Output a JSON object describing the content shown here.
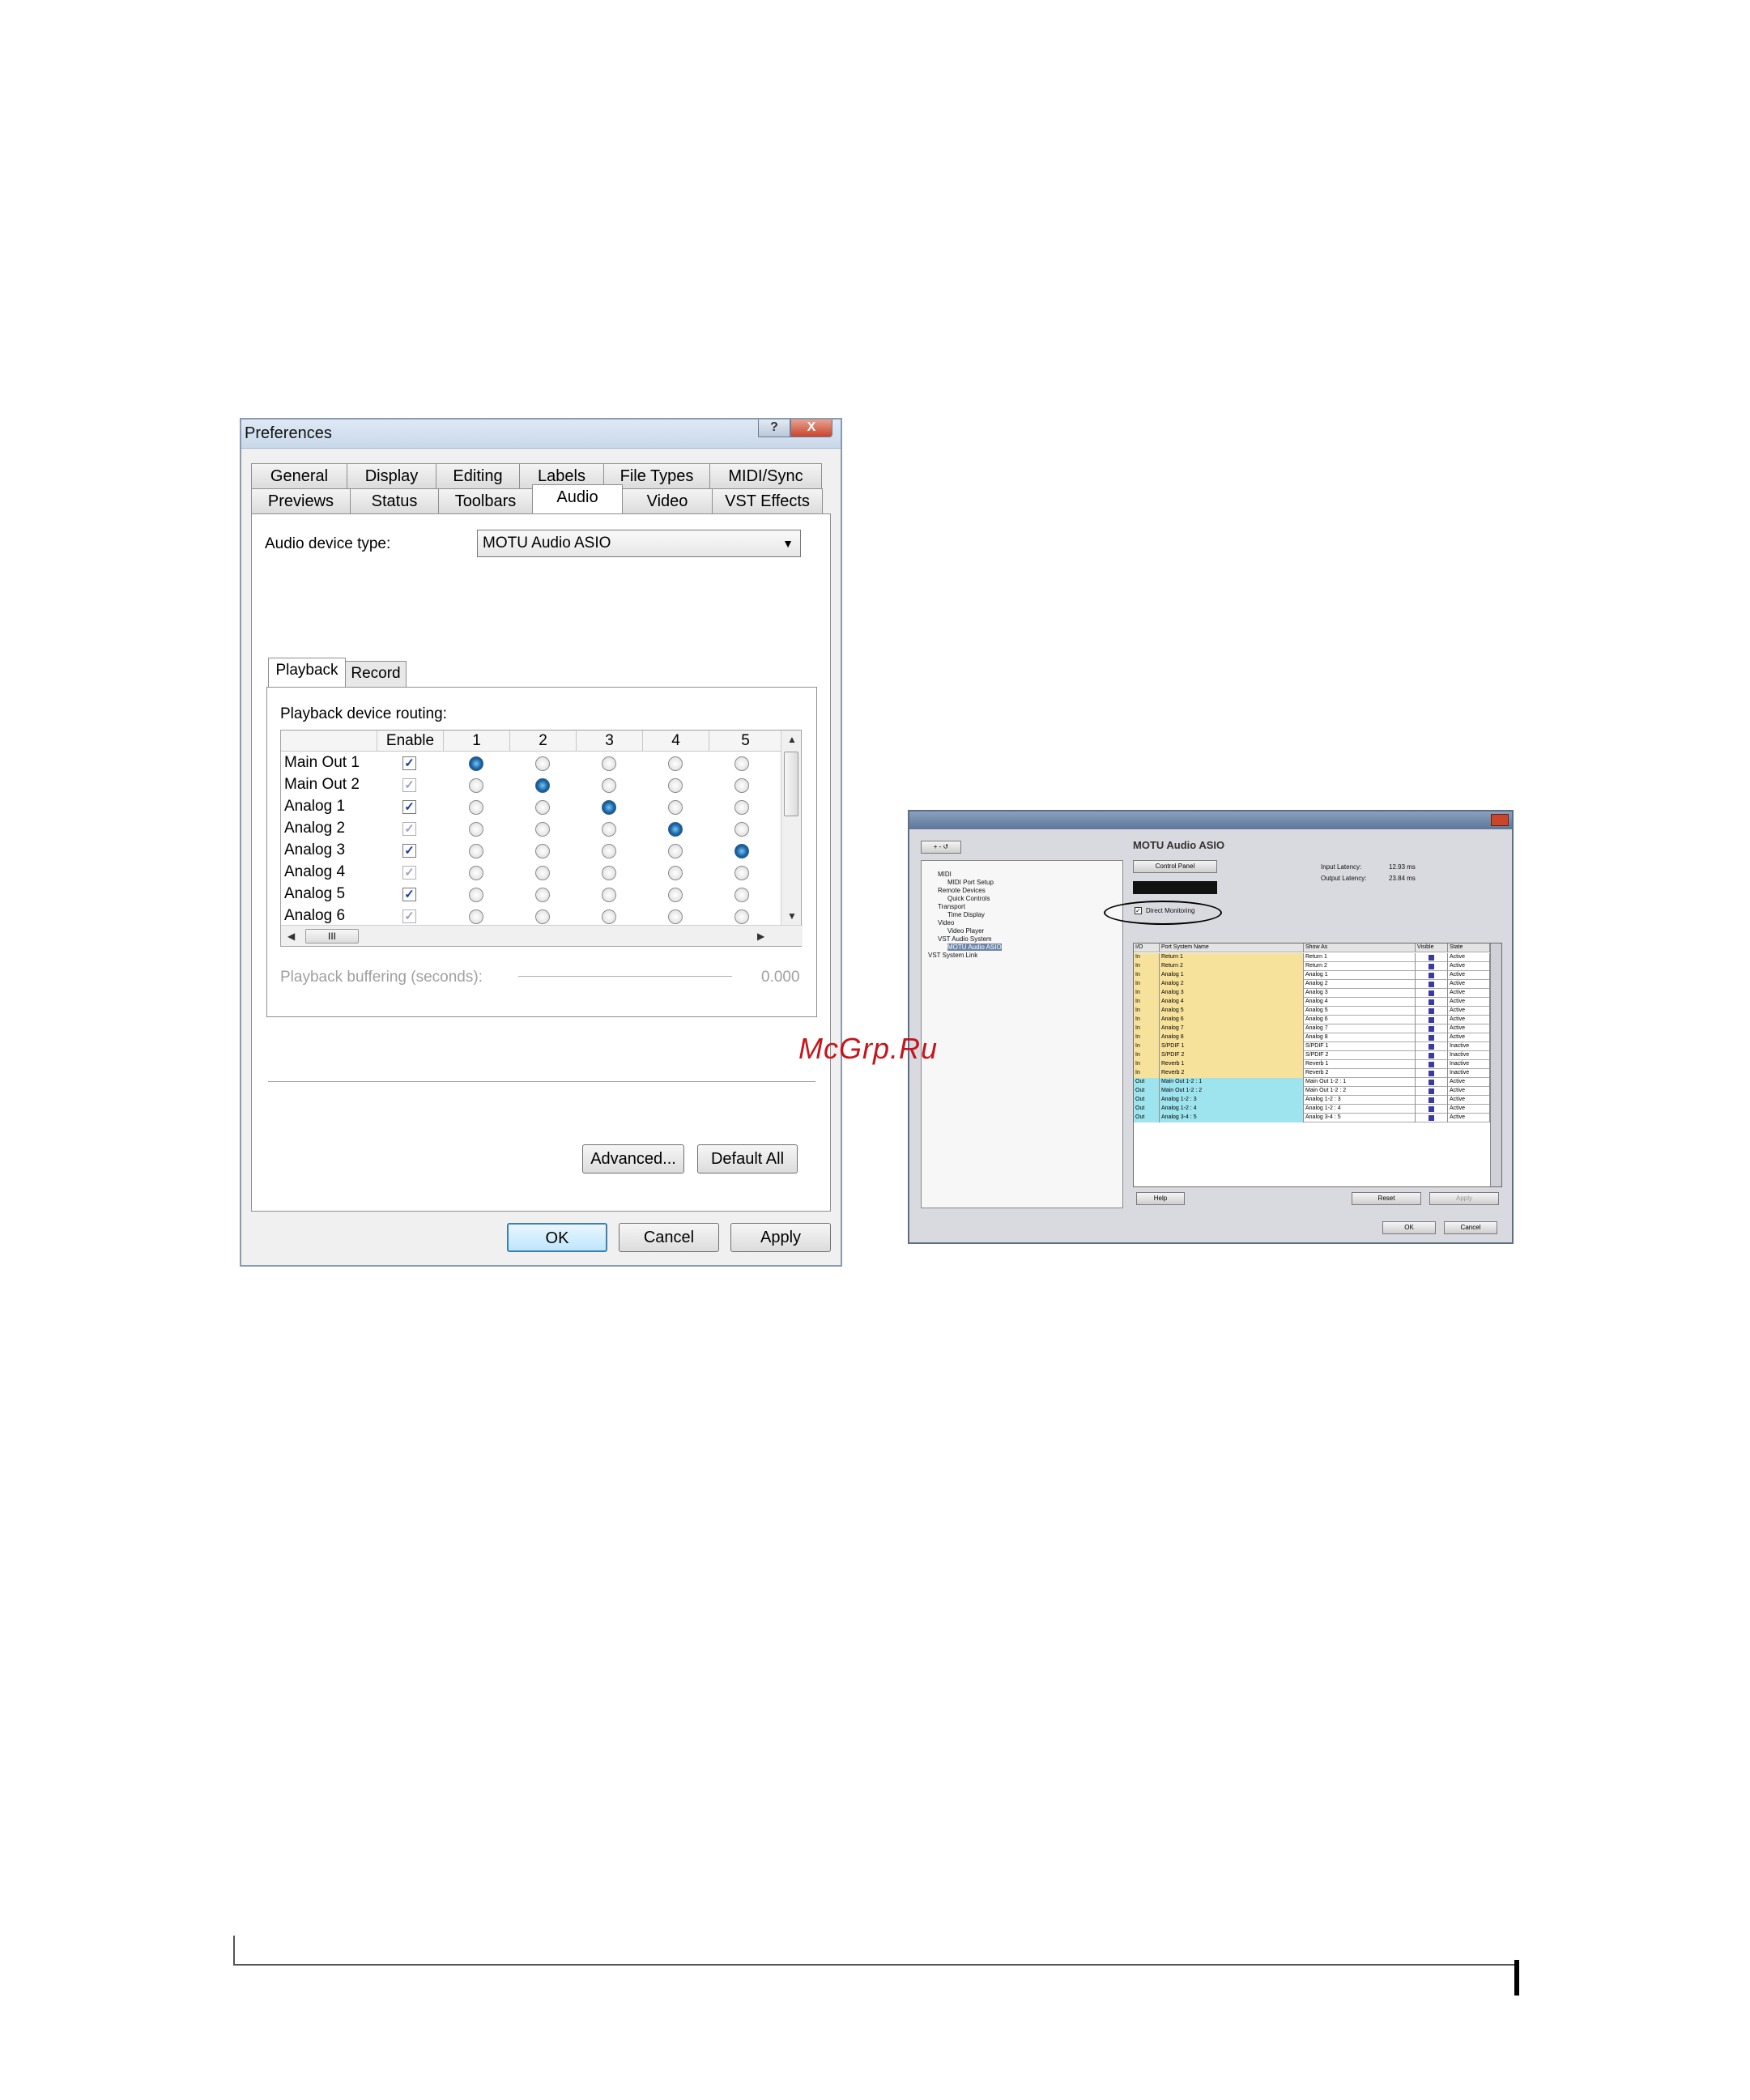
{
  "preferences": {
    "title": "Preferences",
    "help_glyph": "?",
    "close_glyph": "X",
    "tabs_row1": [
      "General",
      "Display",
      "Editing",
      "Labels",
      "File Types",
      "MIDI/Sync"
    ],
    "tabs_row2": [
      "Previews",
      "Status",
      "Toolbars",
      "Audio",
      "Video",
      "VST Effects"
    ],
    "active_tab": "Audio",
    "audio_device_type_label": "Audio device type:",
    "audio_device_type_value": "MOTU Audio ASIO",
    "subtabs": [
      "Playback",
      "Record"
    ],
    "active_subtab": "Playback",
    "routing_label": "Playback device routing:",
    "routing_columns": [
      "Enable",
      "1",
      "2",
      "3",
      "4",
      "5"
    ],
    "routing_rows": [
      {
        "name": "Main Out 1",
        "enabled": true,
        "dimmed": false,
        "selected": 1
      },
      {
        "name": "Main Out 2",
        "enabled": true,
        "dimmed": true,
        "selected": 2
      },
      {
        "name": "Analog 1",
        "enabled": true,
        "dimmed": false,
        "selected": 3
      },
      {
        "name": "Analog 2",
        "enabled": true,
        "dimmed": true,
        "selected": 4
      },
      {
        "name": "Analog 3",
        "enabled": true,
        "dimmed": false,
        "selected": 5
      },
      {
        "name": "Analog 4",
        "enabled": true,
        "dimmed": true,
        "selected": 0
      },
      {
        "name": "Analog 5",
        "enabled": true,
        "dimmed": false,
        "selected": 0
      },
      {
        "name": "Analog 6",
        "enabled": true,
        "dimmed": true,
        "selected": 0
      }
    ],
    "hscroll_thumb_glyph": "III",
    "buffering_label": "Playback buffering (seconds):",
    "buffering_value": "0.000",
    "buttons": {
      "advanced": "Advanced...",
      "default_all": "Default All",
      "ok": "OK",
      "cancel": "Cancel",
      "apply": "Apply"
    }
  },
  "device_setup": {
    "device_name": "MOTU Audio ASIO",
    "control_panel": "Control Panel",
    "input_latency_label": "Input Latency:",
    "input_latency_value": "12.93 ms",
    "output_latency_label": "Output Latency:",
    "output_latency_value": "23.84 ms",
    "direct_monitoring": "Direct Monitoring",
    "tree_items": [
      "MIDI",
      "MIDI Port Setup",
      "Remote Devices",
      "Quick Controls",
      "Transport",
      "Time Display",
      "Video",
      "Video Player",
      "VST Audio System",
      "MOTU Audio ASIO",
      "VST System Link"
    ],
    "grid_headers": [
      "I/O",
      "Port System Name",
      "Show As",
      "Visible",
      "State"
    ],
    "grid_rows": [
      {
        "io": "In",
        "port": "Return 1",
        "show": "Return 1",
        "state": "Active"
      },
      {
        "io": "In",
        "port": "Return 2",
        "show": "Return 2",
        "state": "Active"
      },
      {
        "io": "In",
        "port": "Analog 1",
        "show": "Analog 1",
        "state": "Active"
      },
      {
        "io": "In",
        "port": "Analog 2",
        "show": "Analog 2",
        "state": "Active"
      },
      {
        "io": "In",
        "port": "Analog 3",
        "show": "Analog 3",
        "state": "Active"
      },
      {
        "io": "In",
        "port": "Analog 4",
        "show": "Analog 4",
        "state": "Active"
      },
      {
        "io": "In",
        "port": "Analog 5",
        "show": "Analog 5",
        "state": "Active"
      },
      {
        "io": "In",
        "port": "Analog 6",
        "show": "Analog 6",
        "state": "Active"
      },
      {
        "io": "In",
        "port": "Analog 7",
        "show": "Analog 7",
        "state": "Active"
      },
      {
        "io": "In",
        "port": "Analog 8",
        "show": "Analog 8",
        "state": "Active"
      },
      {
        "io": "In",
        "port": "S/PDIF 1",
        "show": "S/PDIF 1",
        "state": "Inactive"
      },
      {
        "io": "In",
        "port": "S/PDIF 2",
        "show": "S/PDIF 2",
        "state": "Inactive"
      },
      {
        "io": "In",
        "port": "Reverb 1",
        "show": "Reverb 1",
        "state": "Inactive"
      },
      {
        "io": "In",
        "port": "Reverb 2",
        "show": "Reverb 2",
        "state": "Inactive"
      },
      {
        "io": "Out",
        "port": "Main Out 1-2 : 1",
        "show": "Main Out 1-2 : 1",
        "state": "Active"
      },
      {
        "io": "Out",
        "port": "Main Out 1-2 : 2",
        "show": "Main Out 1-2 : 2",
        "state": "Active"
      },
      {
        "io": "Out",
        "port": "Analog 1-2 : 3",
        "show": "Analog 1-2 : 3",
        "state": "Active"
      },
      {
        "io": "Out",
        "port": "Analog 1-2 : 4",
        "show": "Analog 1-2 : 4",
        "state": "Active"
      },
      {
        "io": "Out",
        "port": "Analog 3-4 : 5",
        "show": "Analog 3-4 : 5",
        "state": "Active"
      }
    ],
    "buttons": {
      "help": "Help",
      "reset": "Reset",
      "apply": "Apply",
      "ok": "OK",
      "cancel": "Cancel"
    }
  },
  "watermark": "McGrp.Ru",
  "colors": {
    "accent": "#3c7fb1",
    "radio_on": "#1565a8",
    "in_row": "#f7e29c",
    "out_row": "#9ee4ee",
    "watermark": "#c4161c"
  }
}
